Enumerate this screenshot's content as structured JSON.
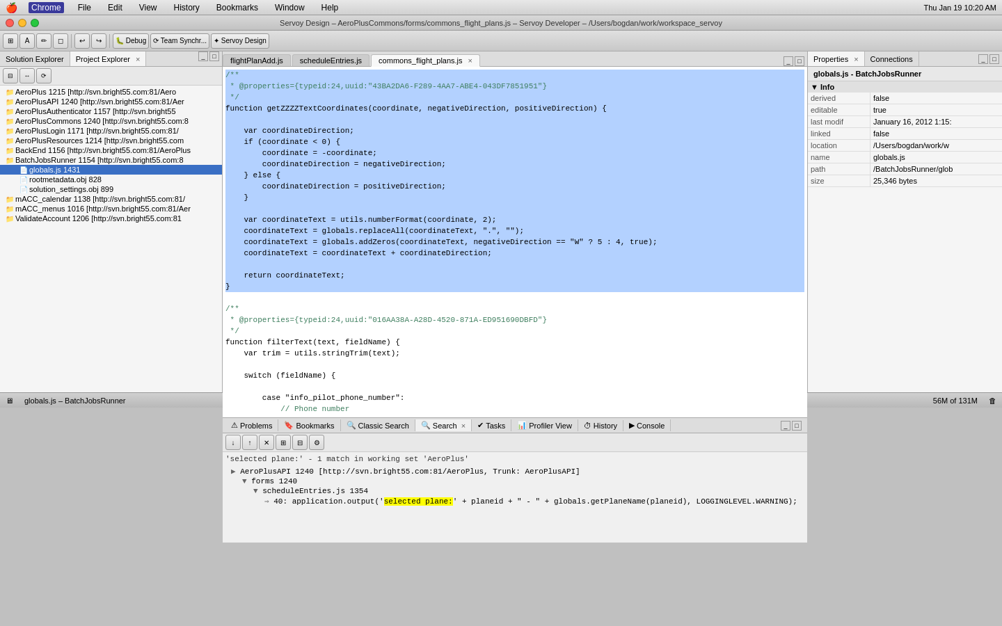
{
  "menuBar": {
    "apple": "🍎",
    "items": [
      "Chrome",
      "File",
      "Edit",
      "View",
      "History",
      "Bookmarks",
      "Window",
      "Help"
    ],
    "activeItem": "Chrome",
    "rightSide": "Thu Jan 19  10:20 AM"
  },
  "titleBar": {
    "text": "Servoy Design – AeroPlusCommons/forms/commons_flight_plans.js – Servoy Developer – /Users/bogdan/work/workspace_servoy"
  },
  "leftPanel": {
    "tabs": [
      "Solution Explorer",
      "Project Explorer"
    ],
    "activeTab": "Project Explorer",
    "treeItems": [
      {
        "label": "AeroPlus 1215 [http://svn.bright55.com:81/Aero",
        "level": 1,
        "icon": "📁"
      },
      {
        "label": "AeroPlusAPI 1240 [http://svn.bright55.com:81/Aer",
        "level": 1,
        "icon": "📁"
      },
      {
        "label": "AeroPlusAuthenticator 1157 [http://svn.bright55",
        "level": 1,
        "icon": "📁"
      },
      {
        "label": "AeroPlusCommons 1240 [http://svn.bright55.com:8",
        "level": 1,
        "icon": "📁"
      },
      {
        "label": "AeroPlusLogin 1171 [http://svn.bright55.com:81/",
        "level": 1,
        "icon": "📁"
      },
      {
        "label": "AeroPlusResources 1214 [http://svn.bright55.com",
        "level": 1,
        "icon": "📁"
      },
      {
        "label": "BackEnd 1156 [http://svn.bright55.com:81/AeroPlus",
        "level": 1,
        "icon": "📁"
      },
      {
        "label": "BatchJobsRunner 1154 [http://svn.bright55.com:8",
        "level": 1,
        "icon": "📁",
        "expanded": true
      },
      {
        "label": "globals.js 1431",
        "level": 2,
        "icon": "📄",
        "selected": true
      },
      {
        "label": "rootmetadata.obj 828",
        "level": 2,
        "icon": "📄"
      },
      {
        "label": "solution_settings.obj 899",
        "level": 2,
        "icon": "📄"
      },
      {
        "label": "mACC_calendar 1138 [http://svn.bright55.com:81/",
        "level": 1,
        "icon": "📁"
      },
      {
        "label": "mACC_menus 1016 [http://svn.bright55.com:81/Aer",
        "level": 1,
        "icon": "📁"
      },
      {
        "label": "ValidateAccount 1206 [http://svn.bright55.com:81",
        "level": 1,
        "icon": "📁"
      }
    ]
  },
  "editorTabs": [
    {
      "label": "flightPlanAdd.js",
      "active": false
    },
    {
      "label": "scheduleEntries.js",
      "active": false
    },
    {
      "label": "commons_flight_plans.js",
      "active": true
    }
  ],
  "codeEditor": {
    "lines": [
      {
        "num": "",
        "text": "/**",
        "selected": true,
        "class": "cm"
      },
      {
        "num": "",
        "text": " * @properties={typeid:24,uuid:\"43BA2DA6-F289-4AA7-ABE4-043DF7851951\"}",
        "selected": true,
        "class": "cm"
      },
      {
        "num": "",
        "text": " */",
        "selected": true,
        "class": "cm"
      },
      {
        "num": "",
        "text": "function getZZZZTextCoordinates(coordinate, negativeDirection, positiveDirection) {",
        "selected": true
      },
      {
        "num": "",
        "text": "",
        "selected": true
      },
      {
        "num": "",
        "text": "    var coordinateDirection;",
        "selected": true
      },
      {
        "num": "",
        "text": "    if (coordinate < 0) {",
        "selected": true
      },
      {
        "num": "",
        "text": "        coordinate = -coordinate;",
        "selected": true
      },
      {
        "num": "",
        "text": "        coordinateDirection = negativeDirection;",
        "selected": true
      },
      {
        "num": "",
        "text": "    } else {",
        "selected": true
      },
      {
        "num": "",
        "text": "        coordinateDirection = positiveDirection;",
        "selected": true
      },
      {
        "num": "",
        "text": "    }",
        "selected": true
      },
      {
        "num": "",
        "text": "",
        "selected": true
      },
      {
        "num": "",
        "text": "    var coordinateText = utils.numberFormat(coordinate, 2);",
        "selected": true
      },
      {
        "num": "",
        "text": "    coordinateText = globals.replaceAll(coordinateText, \".\", \"\");",
        "selected": true
      },
      {
        "num": "",
        "text": "    coordinateText = globals.addZeros(coordinateText, negativeDirection == \"W\" ? 5 : 4, true);",
        "selected": true
      },
      {
        "num": "",
        "text": "    coordinateText = coordinateText + coordinateDirection;",
        "selected": true
      },
      {
        "num": "",
        "text": "",
        "selected": true
      },
      {
        "num": "",
        "text": "    return coordinateText;",
        "selected": true
      },
      {
        "num": "",
        "text": "}",
        "selected": true
      },
      {
        "num": "",
        "text": "",
        "selected": false
      },
      {
        "num": "",
        "text": "/**",
        "selected": false,
        "class": "cm"
      },
      {
        "num": "",
        "text": " * @properties={typeid:24,uuid:\"016AA38A-A28D-4520-871A-ED951690DBFD\"}",
        "selected": false,
        "class": "cm"
      },
      {
        "num": "",
        "text": " */",
        "selected": false,
        "class": "cm"
      },
      {
        "num": "",
        "text": "function filterText(text, fieldName) {",
        "selected": false
      },
      {
        "num": "",
        "text": "    var trim = utils.stringTrim(text);",
        "selected": false
      },
      {
        "num": "",
        "text": "",
        "selected": false
      },
      {
        "num": "",
        "text": "    switch (fieldName) {",
        "selected": false
      },
      {
        "num": "",
        "text": "",
        "selected": false
      },
      {
        "num": "",
        "text": "        case \"info_pilot_phone_number\":",
        "selected": false
      },
      {
        "num": "",
        "text": "            // Phone number",
        "selected": false,
        "class": "cm"
      }
    ]
  },
  "rightPanel": {
    "tabs": [
      "Properties",
      "Connections"
    ],
    "activeTab": "Properties",
    "header": "globals.js - BatchJobsRunner",
    "sectionLabel": "Info",
    "properties": [
      {
        "name": "derived",
        "value": "false"
      },
      {
        "name": "editable",
        "value": "true"
      },
      {
        "name": "last modif",
        "value": "January 16, 2012 1:15:"
      },
      {
        "name": "linked",
        "value": "false"
      },
      {
        "name": "location",
        "value": "/Users/bogdan/work/w"
      },
      {
        "name": "name",
        "value": "globals.js"
      },
      {
        "name": "path",
        "value": "/BatchJobsRunner/glob"
      },
      {
        "name": "size",
        "value": "25,346  bytes"
      }
    ]
  },
  "bottomPanel": {
    "tabs": [
      "Problems",
      "Bookmarks",
      "Classic Search",
      "Search",
      "Tasks",
      "Profiler View",
      "History",
      "Console"
    ],
    "activeTab": "Search",
    "searchResult": {
      "header": "'selected plane:' - 1 match in working set 'AeroPlus'",
      "items": [
        {
          "label": "AeroPlusAPI 1240 [http://svn.bright55.com:81/AeroPlus, Trunk: AeroPlusAPI]",
          "level": 0,
          "arrow": "▶"
        },
        {
          "label": "forms 1240",
          "level": 1,
          "arrow": "▼"
        },
        {
          "label": "scheduleEntries.js 1354",
          "level": 2,
          "arrow": "▼"
        },
        {
          "label": "40: application.output('selected plane:' + planeid + \" - \" + globals.getPlaneName(planeid), LOGGINGLEVEL.WARNING);",
          "level": 3,
          "arrow": "⇒",
          "highlight": "selected plane:"
        }
      ]
    }
  },
  "statusBar": {
    "file": "globals.js – BatchJobsRunner",
    "memory": "56M of 131M",
    "icon": "🗑"
  }
}
